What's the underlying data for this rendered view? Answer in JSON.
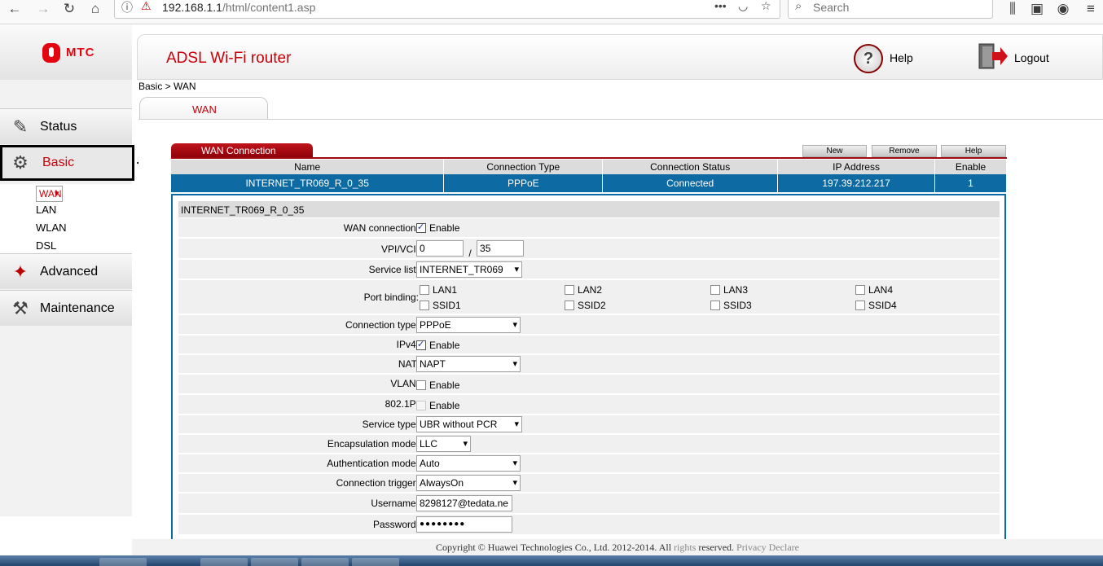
{
  "browser": {
    "url_host": "192.168.1.1",
    "url_path": "/html/content1.asp",
    "search_placeholder": "Search"
  },
  "brand": {
    "logo_text": "МТС",
    "product_title": "ADSL Wi-Fi router"
  },
  "header": {
    "help_label": "Help",
    "logout_label": "Logout"
  },
  "sidebar": {
    "items": [
      {
        "label": "Status",
        "icon": "status-icon"
      },
      {
        "label": "Basic",
        "icon": "gear-icon",
        "active": true
      },
      {
        "label": "Advanced",
        "icon": "advanced-icon"
      },
      {
        "label": "Maintenance",
        "icon": "maintenance-icon"
      }
    ],
    "subitems": [
      "WAN",
      "LAN",
      "WLAN",
      "DSL"
    ]
  },
  "breadcrumb": "Basic > WAN",
  "tab": "WAN",
  "wan": {
    "panel_title": "WAN Connection",
    "buttons": {
      "new": "New",
      "remove": "Remove",
      "help": "Help"
    },
    "columns": [
      "Name",
      "Connection Type",
      "Connection Status",
      "IP Address",
      "Enable"
    ],
    "row": [
      "INTERNET_TR069_R_0_35",
      "PPPoE",
      "Connected",
      "197.39.212.217",
      "1"
    ]
  },
  "detail": {
    "title": "INTERNET_TR069_R_0_35",
    "wan_connection_label": "WAN connection:",
    "enable_text": "Enable",
    "vpivci_label": "VPI/VCI:",
    "vpi": "0",
    "slash": "/",
    "vci": "35",
    "service_list_label": "Service list:",
    "service_list_value": "INTERNET_TR069",
    "port_binding_label": "Port binding:",
    "ports": [
      "LAN1",
      "LAN2",
      "LAN3",
      "LAN4"
    ],
    "ssids": [
      "SSID1",
      "SSID2",
      "SSID3",
      "SSID4"
    ],
    "connection_type_label": "Connection type:",
    "connection_type_value": "PPPoE",
    "ipv4_label": "IPv4:",
    "nat_label": "NAT:",
    "nat_value": "NAPT",
    "vlan_label": "VLAN:",
    "dot1p_label": "802.1P:",
    "service_type_label": "Service type:",
    "service_type_value": "UBR without PCR",
    "encap_label": "Encapsulation mode:",
    "encap_value": "LLC",
    "auth_label": "Authentication mode:",
    "auth_value": "Auto",
    "trigger_label": "Connection trigger:",
    "trigger_value": "AlwaysOn",
    "username_label": "Username:",
    "username_value": "8298127@tedata.ne",
    "password_label": "Password:",
    "password_value": "●●●●●●●●"
  },
  "footer": {
    "copyright": "Copyright © Huawei Technologies Co., Ltd. 2012-2014. All",
    "rights": "rights",
    "reserved": "reserved.",
    "privacy": "Privacy Declare"
  },
  "colors": {
    "accent_red": "#c8000a",
    "selected_row_blue": "#0e6aa2"
  }
}
